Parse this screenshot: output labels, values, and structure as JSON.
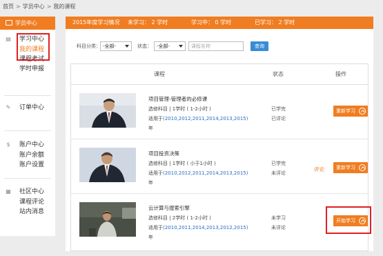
{
  "breadcrumb": [
    "首页",
    "学员中心",
    "我的课程"
  ],
  "sidebar": {
    "header": "学员中心",
    "sections": [
      {
        "title": "学习中心",
        "icon": "book-icon",
        "items": [
          "我的课程",
          "课程考试",
          "学时申报"
        ]
      },
      {
        "title": "订单中心",
        "icon": "pen-icon",
        "items": []
      },
      {
        "title": "账户中心",
        "icon": "coin-icon",
        "items": [
          "账户余额",
          "账户设置"
        ]
      },
      {
        "title": "社区中心",
        "icon": "grid-icon",
        "items": [
          "课程评论",
          "站内消息"
        ]
      }
    ]
  },
  "summary": {
    "year_label": "2015年度学习情况",
    "not_started": "未学习： 2 学时",
    "in_progress": "学习中： 0 学时",
    "completed": "已学习： 2 学时"
  },
  "filter": {
    "subject_label": "科目分类：",
    "subject_value": "-全部-",
    "status_label": "状态：",
    "status_value": "-全部-",
    "search_placeholder": "课程名称",
    "search_button": "查询"
  },
  "table": {
    "col_course": "课程",
    "col_status": "状态",
    "col_action": "操作",
    "rows": [
      {
        "title": "项目管理-管理者的必修课",
        "type": "选修科目 | 1学时 ( 1-2小时 )",
        "applies_prefix": "适用于",
        "years": "(2010,2012,2011,2014,2013,2015)",
        "years_suffix": "年",
        "study_status": "已学完",
        "review_status": "已评论",
        "review_link": "",
        "button": "重新学习"
      },
      {
        "title": "项目投资决策",
        "type": "选修科目 | 1学时 ( 小于1小时 )",
        "applies_prefix": "适用于",
        "years": "(2010,2012,2011,2014,2013,2015)",
        "years_suffix": "年",
        "study_status": "已学完",
        "review_status": "未评论",
        "review_link": "评论",
        "button": "重新学习"
      },
      {
        "title": "云计算与搜索引擎",
        "type": "选修科目 | 2学时 ( 1-2小时 )",
        "applies_prefix": "适用于",
        "years": "(2010,2011,2014,2013,2012,2015)",
        "years_suffix": "年",
        "study_status": "未学习",
        "review_status": "未评论",
        "review_link": "",
        "button": "开始学习"
      }
    ]
  },
  "colors": {
    "accent": "#f07d21",
    "link": "#2a6bbf",
    "highlight_box": "#e01e1e",
    "query_button": "#3a8bd6"
  }
}
